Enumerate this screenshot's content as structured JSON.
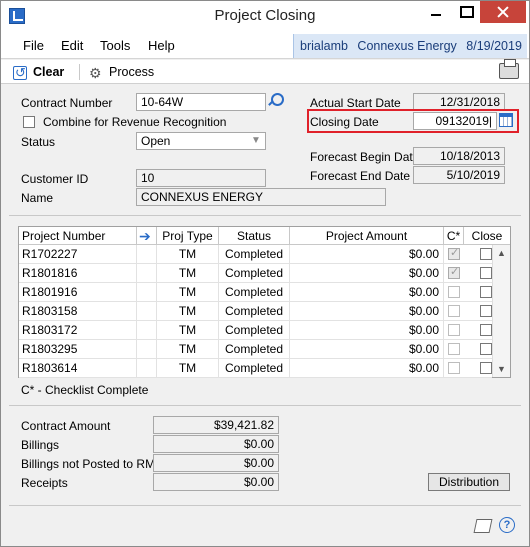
{
  "window": {
    "title": "Project Closing"
  },
  "menu": [
    "File",
    "Edit",
    "Tools",
    "Help"
  ],
  "user_info": {
    "user": "brialamb",
    "company": "Connexus Energy",
    "date": "8/19/2019"
  },
  "toolbar": {
    "clear_label": "Clear",
    "process_label": "Process"
  },
  "form": {
    "contract_number_label": "Contract Number",
    "contract_number": "10-64W",
    "combine_label": "Combine for Revenue Recognition",
    "status_label": "Status",
    "status": "Open",
    "customer_id_label": "Customer ID",
    "customer_id": "10",
    "name_label": "Name",
    "name": "CONNEXUS ENERGY",
    "actual_start_label": "Actual Start Date",
    "actual_start": "12/31/2018",
    "closing_date_label": "Closing Date",
    "closing_date": "09132019|",
    "forecast_begin_label": "Forecast Begin Date",
    "forecast_begin": "10/18/2013",
    "forecast_end_label": "Forecast End Date",
    "forecast_end": "5/10/2019"
  },
  "grid": {
    "headers": {
      "project_number": "Project Number",
      "proj_type": "Proj Type",
      "status": "Status",
      "amount": "Project Amount",
      "checklist": "C*",
      "close": "Close"
    },
    "rows": [
      {
        "project_number": "R1702227",
        "proj_type": "TM",
        "status": "Completed",
        "amount": "$0.00",
        "checklist": true,
        "close": false
      },
      {
        "project_number": "R1801816",
        "proj_type": "TM",
        "status": "Completed",
        "amount": "$0.00",
        "checklist": true,
        "close": false
      },
      {
        "project_number": "R1801916",
        "proj_type": "TM",
        "status": "Completed",
        "amount": "$0.00",
        "checklist": false,
        "close": false
      },
      {
        "project_number": "R1803158",
        "proj_type": "TM",
        "status": "Completed",
        "amount": "$0.00",
        "checklist": false,
        "close": false
      },
      {
        "project_number": "R1803172",
        "proj_type": "TM",
        "status": "Completed",
        "amount": "$0.00",
        "checklist": false,
        "close": false
      },
      {
        "project_number": "R1803295",
        "proj_type": "TM",
        "status": "Completed",
        "amount": "$0.00",
        "checklist": false,
        "close": false
      },
      {
        "project_number": "R1803614",
        "proj_type": "TM",
        "status": "Completed",
        "amount": "$0.00",
        "checklist": false,
        "close": false
      }
    ]
  },
  "legend_text": "C* - Checklist Complete",
  "summary": {
    "contract_amount_label": "Contract Amount",
    "contract_amount": "$39,421.82",
    "billings_label": "Billings",
    "billings": "$0.00",
    "billings_not_posted_label": "Billings not Posted to RM",
    "billings_not_posted": "$0.00",
    "receipts_label": "Receipts",
    "receipts": "$0.00"
  },
  "buttons": {
    "distribution": "Distribution"
  },
  "colors": {
    "highlight": "#e0212a",
    "accent": "#2a6cc7",
    "userinfo_bg": "#dbe7f6"
  }
}
